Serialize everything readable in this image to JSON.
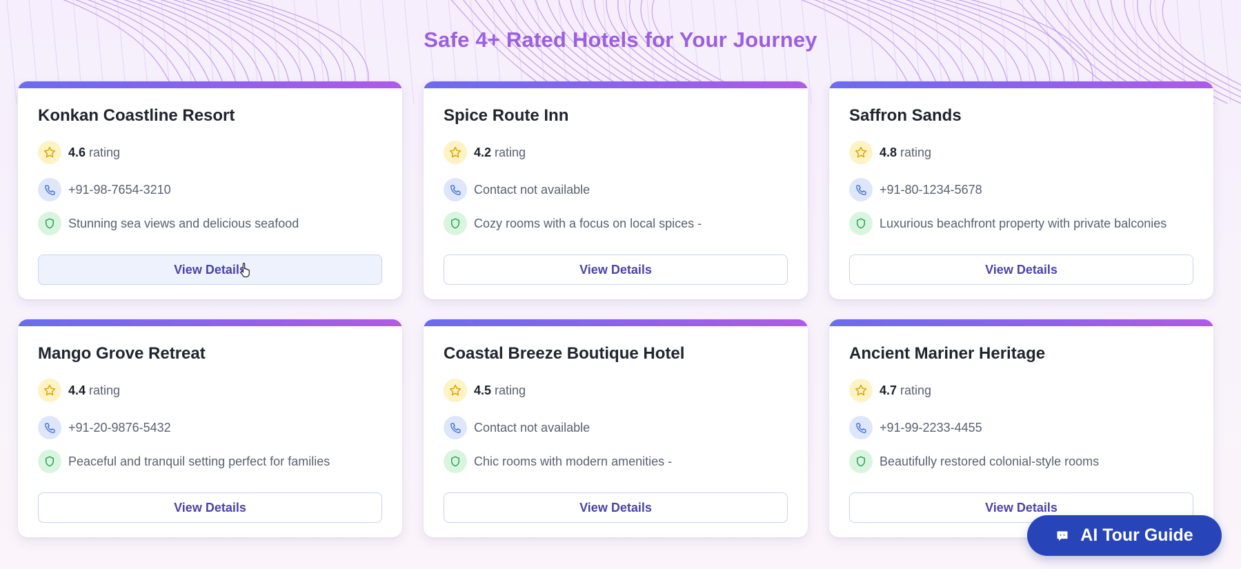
{
  "page": {
    "title": "Safe 4+ Rated Hotels for Your Journey"
  },
  "colors": {
    "accent_gradient_start": "#6a6cf0",
    "accent_gradient_end": "#b05ae8",
    "title": "#9b5fe0",
    "button_text": "#4b43a8",
    "fab_background": "#2745b8"
  },
  "hotels": [
    {
      "name": "Konkan Coastline Resort",
      "rating": "4.6",
      "rating_suffix": "rating",
      "contact": "+91-98-7654-3210",
      "description": "Stunning sea views and delicious seafood",
      "button_label": "View Details"
    },
    {
      "name": "Spice Route Inn",
      "rating": "4.2",
      "rating_suffix": "rating",
      "contact": "Contact not available",
      "description": "Cozy rooms with a focus on local spices -",
      "button_label": "View Details"
    },
    {
      "name": "Saffron Sands",
      "rating": "4.8",
      "rating_suffix": "rating",
      "contact": "+91-80-1234-5678",
      "description": "Luxurious beachfront property with private balconies",
      "button_label": "View Details"
    },
    {
      "name": "Mango Grove Retreat",
      "rating": "4.4",
      "rating_suffix": "rating",
      "contact": "+91-20-9876-5432",
      "description": "Peaceful and tranquil setting perfect for families",
      "button_label": "View Details"
    },
    {
      "name": "Coastal Breeze Boutique Hotel",
      "rating": "4.5",
      "rating_suffix": "rating",
      "contact": "Contact not available",
      "description": "Chic rooms with modern amenities -",
      "button_label": "View Details"
    },
    {
      "name": "Ancient Mariner Heritage",
      "rating": "4.7",
      "rating_suffix": "rating",
      "contact": "+91-99-2233-4455",
      "description": "Beautifully restored colonial-style rooms",
      "button_label": "View Details"
    }
  ],
  "icons": {
    "rating": "star-icon",
    "contact": "phone-icon",
    "safety": "shield-icon",
    "chat": "chat-icon"
  },
  "fab": {
    "label": "AI Tour Guide"
  }
}
